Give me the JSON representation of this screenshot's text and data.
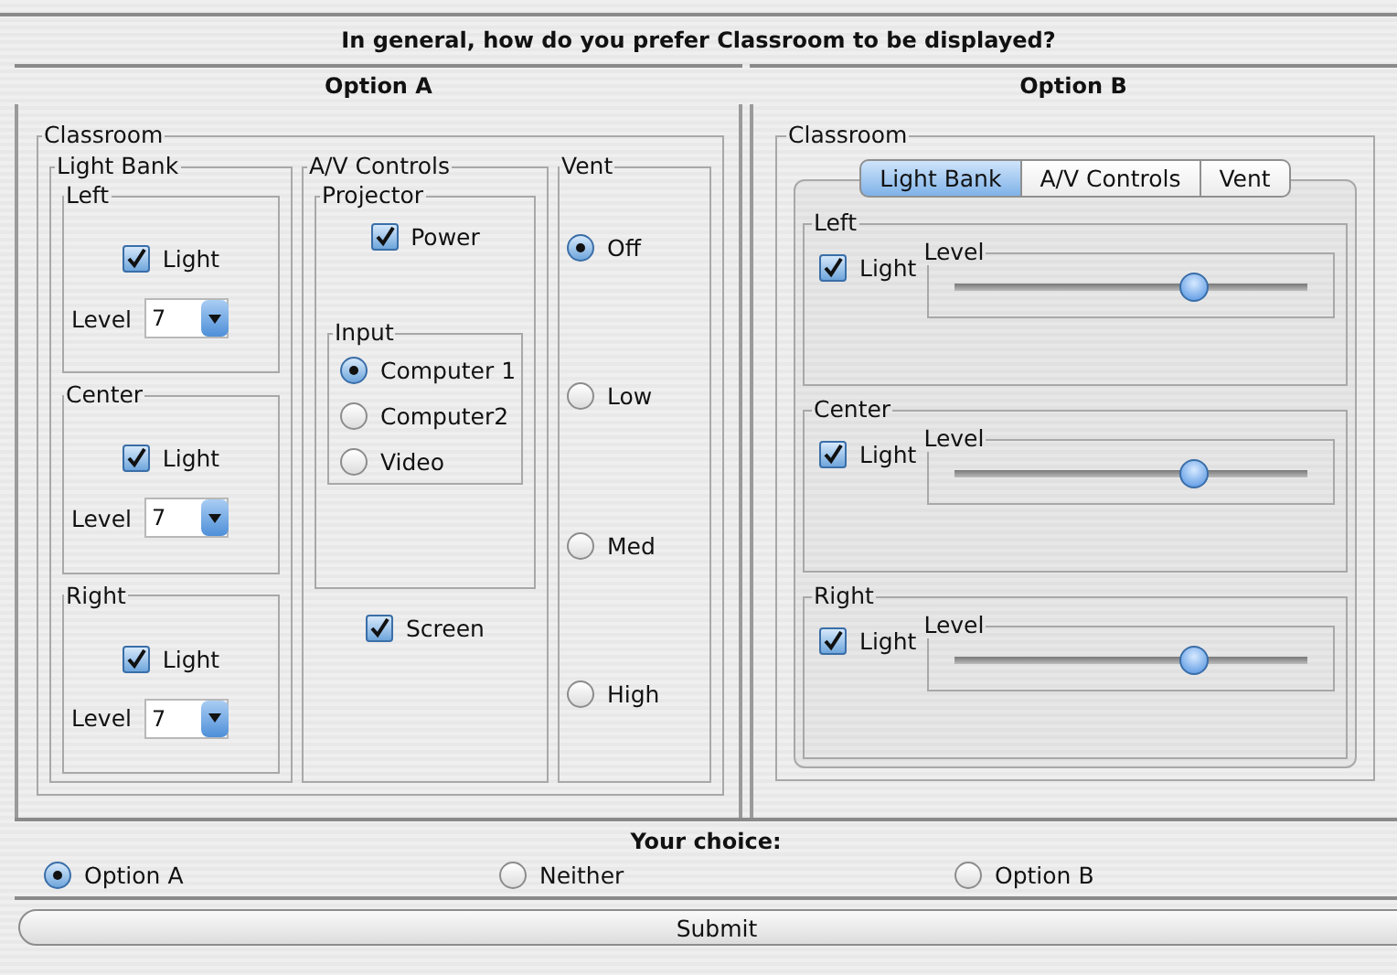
{
  "question": "In general, how do you prefer Classroom to be displayed?",
  "option_a": {
    "title": "Option A",
    "group": "Classroom",
    "light_bank": {
      "title": "Light Bank",
      "lights": [
        {
          "title": "Left",
          "label": "Light",
          "checked": true,
          "level_label": "Level",
          "value": "7"
        },
        {
          "title": "Center",
          "label": "Light",
          "checked": true,
          "level_label": "Level",
          "value": "7"
        },
        {
          "title": "Right",
          "label": "Light",
          "checked": true,
          "level_label": "Level",
          "value": "7"
        }
      ]
    },
    "av_controls": {
      "title": "A/V Controls",
      "projector": {
        "title": "Projector",
        "power": {
          "label": "Power",
          "checked": true
        },
        "input": {
          "title": "Input",
          "options": [
            {
              "label": "Computer 1",
              "selected": true
            },
            {
              "label": "Computer2",
              "selected": false
            },
            {
              "label": "Video",
              "selected": false
            }
          ]
        }
      },
      "screen": {
        "label": "Screen",
        "checked": true
      }
    },
    "vent": {
      "title": "Vent",
      "options": [
        {
          "label": "Off",
          "selected": true
        },
        {
          "label": "Low",
          "selected": false
        },
        {
          "label": "Med",
          "selected": false
        },
        {
          "label": "High",
          "selected": false
        }
      ]
    }
  },
  "option_b": {
    "title": "Option B",
    "group": "Classroom",
    "tabs": [
      {
        "label": "Light Bank",
        "selected": true
      },
      {
        "label": "A/V Controls",
        "selected": false
      },
      {
        "label": "Vent",
        "selected": false
      }
    ],
    "lights": [
      {
        "title": "Left",
        "label": "Light",
        "checked": true,
        "slider_label": "Level",
        "level": 0.68
      },
      {
        "title": "Center",
        "label": "Light",
        "checked": true,
        "slider_label": "Level",
        "level": 0.68
      },
      {
        "title": "Right",
        "label": "Light",
        "checked": true,
        "slider_label": "Level",
        "level": 0.68
      }
    ]
  },
  "choice": {
    "title": "Your choice:",
    "options": [
      {
        "label": "Option A",
        "selected": true
      },
      {
        "label": "Neither",
        "selected": false
      },
      {
        "label": "Option B",
        "selected": false
      }
    ]
  },
  "submit": "Submit"
}
